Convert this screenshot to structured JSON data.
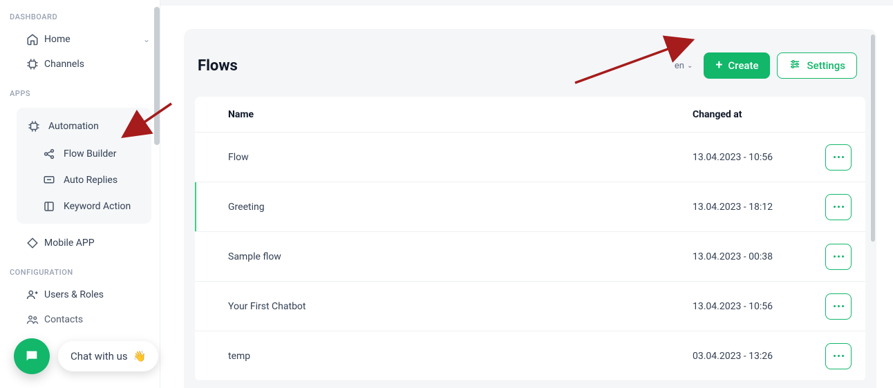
{
  "sidebar": {
    "sections": {
      "dashboard_label": "DASHBOARD",
      "apps_label": "APPS",
      "config_label": "CONFIGURATION"
    },
    "home": "Home",
    "channels": "Channels",
    "automation": {
      "label": "Automation",
      "flow_builder": "Flow Builder",
      "auto_replies": "Auto Replies",
      "keyword_action": "Keyword Action"
    },
    "mobile_app": "Mobile APP",
    "users_roles": "Users & Roles",
    "contacts": "Contacts"
  },
  "main": {
    "title": "Flows",
    "lang": "en",
    "create_label": "Create",
    "settings_label": "Settings",
    "columns": {
      "name": "Name",
      "changed": "Changed at"
    },
    "rows": [
      {
        "name": "Flow",
        "changed": "13.04.2023 - 10:56",
        "selected": false
      },
      {
        "name": "Greeting",
        "changed": "13.04.2023 - 18:12",
        "selected": true
      },
      {
        "name": "Sample flow",
        "changed": "13.04.2023 - 00:38",
        "selected": false
      },
      {
        "name": "Your First Chatbot",
        "changed": "13.04.2023 - 10:56",
        "selected": false
      },
      {
        "name": "temp",
        "changed": "03.04.2023 - 13:26",
        "selected": false
      }
    ]
  },
  "chat": {
    "label": "Chat with us",
    "emoji": "👋"
  },
  "colors": {
    "primary": "#12b76a",
    "arrow": "#a61b1b"
  }
}
